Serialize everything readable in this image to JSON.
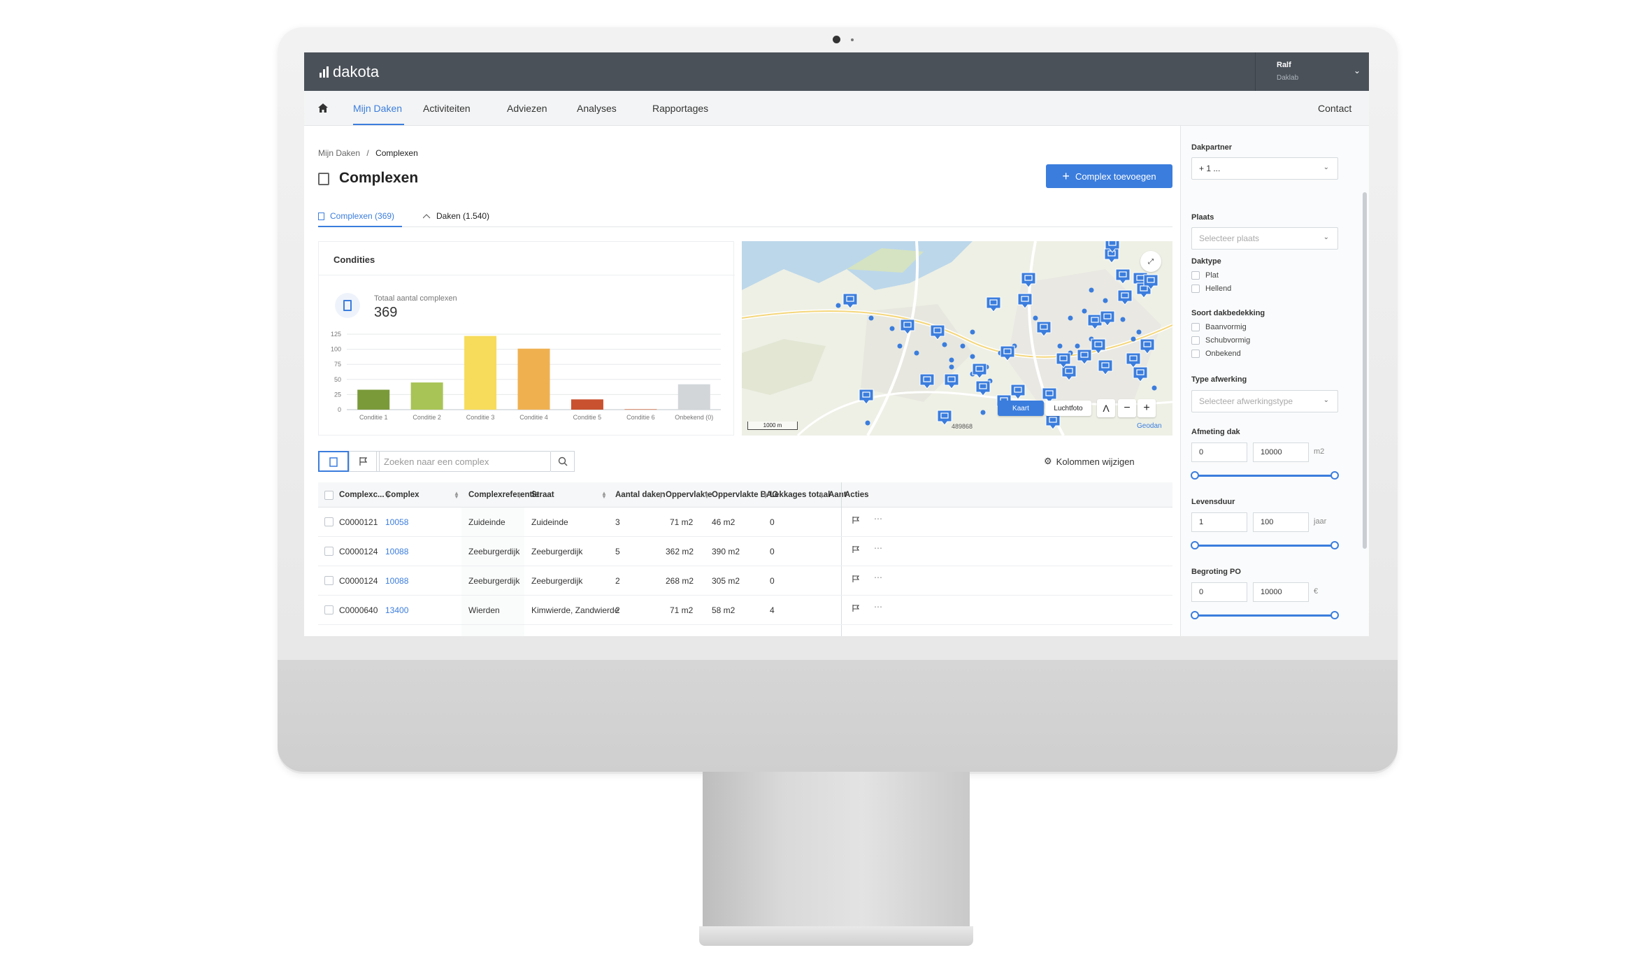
{
  "app": {
    "brand": "dakota",
    "user_name": "Ralf",
    "user_org": "Daklab"
  },
  "nav": {
    "items": [
      "Mijn Daken",
      "Activiteiten",
      "Adviezen",
      "Analyses",
      "Rapportages"
    ],
    "active": "Mijn Daken",
    "contact": "Contact"
  },
  "breadcrumb": {
    "parent": "Mijn Daken",
    "separator": "/",
    "current": "Complexen"
  },
  "page": {
    "title": "Complexen",
    "add_button": "Complex toevoegen"
  },
  "tabs": [
    {
      "label": "Complexen (369)",
      "active": true
    },
    {
      "label": "Daken (1.540)",
      "active": false
    }
  ],
  "conditions": {
    "title": "Condities",
    "total_label": "Totaal aantal complexen",
    "total_value": "369"
  },
  "chart_data": {
    "type": "bar",
    "categories": [
      "Conditie 1",
      "Conditie 2",
      "Conditie 3",
      "Conditie 4",
      "Conditie 5",
      "Conditie 6",
      "Onbekend (0)"
    ],
    "values": [
      33,
      45,
      122,
      101,
      17,
      1,
      42
    ],
    "colors": [
      "#7a9a3a",
      "#a8c456",
      "#f7dc5b",
      "#efb150",
      "#c9512f",
      "#d98a6a",
      "#d2d6d9"
    ],
    "yticks": [
      0,
      25,
      50,
      75,
      100,
      125
    ],
    "ylim": [
      0,
      125
    ],
    "grid": true
  },
  "map": {
    "mode_kaart": "Kaart",
    "mode_luchtfoto": "Luchtfoto",
    "scale_label": "1000 m",
    "coordinate_label": "489868",
    "attribution": "Geodan",
    "accent": "#3b7ddd"
  },
  "toolbar": {
    "search_placeholder": "Zoeken naar een complex",
    "columns_button": "Kolommen wijzigen"
  },
  "table": {
    "columns": [
      "Complexc...",
      "Complex",
      "Complexreferentie",
      "Straat",
      "Aantal daken",
      "Oppervlakte",
      "Oppervlakte BAG",
      "Lekkages totaal",
      "Aant",
      "Acties"
    ],
    "rows": [
      [
        "C0000121",
        "10058",
        "Zuideinde",
        "Zuideinde",
        "3",
        "71 m2",
        "46 m2",
        "0"
      ],
      [
        "C0000124",
        "10088",
        "Zeeburgerdijk",
        "Zeeburgerdijk",
        "5",
        "362 m2",
        "390 m2",
        "0"
      ],
      [
        "C0000124",
        "10088",
        "Zeeburgerdijk",
        "Zeeburgerdijk",
        "2",
        "268 m2",
        "305 m2",
        "0"
      ],
      [
        "C0000640",
        "13400",
        "Wierden",
        "Kimwierde, Zandwierde",
        "2",
        "71 m2",
        "58 m2",
        "4"
      ]
    ]
  },
  "filters": {
    "dakpartner": {
      "label": "Dakpartner",
      "value": "+ 1 ..."
    },
    "plaats": {
      "label": "Plaats",
      "placeholder": "Selecteer plaats"
    },
    "daktype": {
      "label": "Daktype",
      "options": [
        "Plat",
        "Hellend"
      ]
    },
    "dakbedekking": {
      "label": "Soort dakbedekking",
      "options": [
        "Baanvormig",
        "Schubvormig",
        "Onbekend"
      ]
    },
    "afwerking": {
      "label": "Type afwerking",
      "placeholder": "Selecteer afwerkingstype"
    },
    "afmeting": {
      "label": "Afmeting dak",
      "min": "0",
      "max": "10000",
      "unit": "m2"
    },
    "levensduur": {
      "label": "Levensduur",
      "min": "1",
      "max": "100",
      "unit": "jaar"
    },
    "begroting": {
      "label": "Begroting PO",
      "min": "0",
      "max": "10000",
      "unit": "€"
    }
  }
}
